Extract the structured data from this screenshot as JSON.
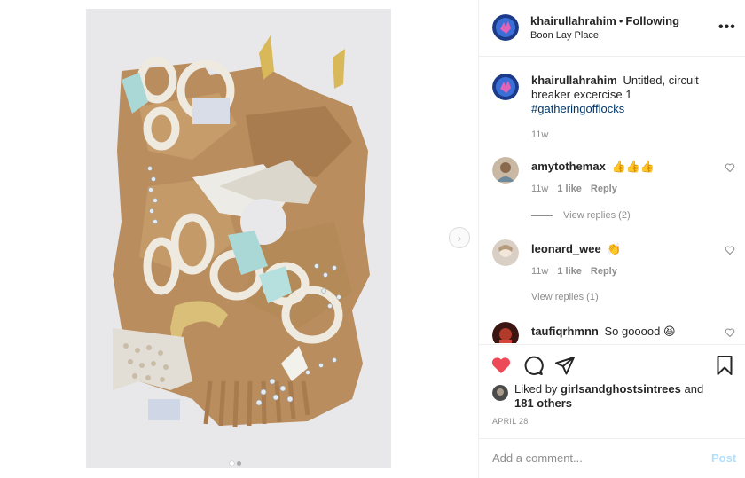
{
  "post": {
    "username": "khairullahrahim",
    "separator": "•",
    "follow_status": "Following",
    "location": "Boon Lay Place",
    "more_icon": "more-horizontal-icon",
    "carousel": {
      "total": 2,
      "current": 1
    }
  },
  "caption": {
    "username": "khairullahrahim",
    "text": "Untitled, circuit breaker excercise 1",
    "hashtag": "#gatheringofflocks",
    "time": "11w"
  },
  "comments": [
    {
      "username": "amytothemax",
      "text": "👍👍👍",
      "time": "11w",
      "likes": "1 like",
      "reply_label": "Reply",
      "view_replies": "View replies (2)"
    },
    {
      "username": "leonard_wee",
      "text": "👏",
      "time": "11w",
      "likes": "1 like",
      "reply_label": "Reply",
      "view_replies": "View replies (1)"
    },
    {
      "username": "taufiqrhmnn",
      "text": "So gooood 😆"
    }
  ],
  "likes": {
    "prefix": "Liked by",
    "user": "girlsandghostsintrees",
    "middle": "and",
    "others": "181 others"
  },
  "date": "APRIL 28",
  "add_comment": {
    "placeholder": "Add a comment...",
    "post_label": "Post"
  },
  "colors": {
    "like_red": "#ed4956",
    "post_disabled": "#b2dffc",
    "hashtag": "#00376b",
    "muted": "#8e8e8e"
  }
}
